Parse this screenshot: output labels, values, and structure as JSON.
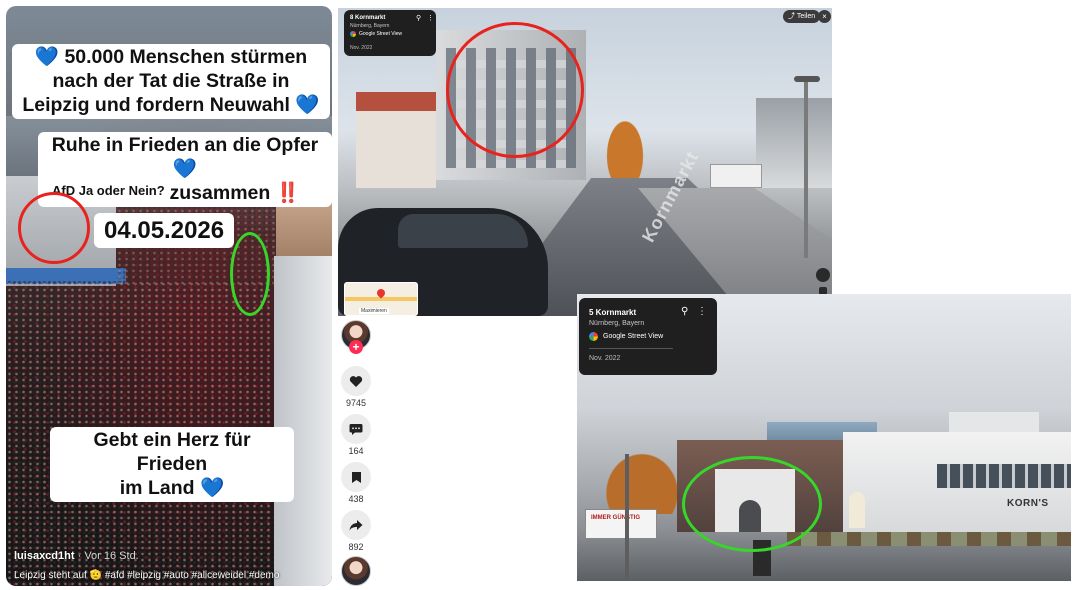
{
  "tiktok": {
    "caption_main": "💙 50.000 Menschen stürmen nach der Tat die Straße in Leipzig und fordern Neuwahl 💙",
    "caption_main_lines": [
      "50.000 Menschen stürmen",
      "nach der Tat die Straße in",
      "Leipzig und fordern Neuwahl"
    ],
    "caption_ruhe_line1": "Ruhe in Frieden an die Opfer",
    "caption_ruhe_line2": "Wir halten zusammen",
    "caption_afd": "AfD Ja oder Nein?",
    "caption_date": "04.05.2026",
    "caption_herz_line1": "Gebt ein Herz für Frieden",
    "caption_herz_line2": "im Land",
    "username": "luisaxcd1ht",
    "time_ago": "· Vor 16 Std.",
    "description": "Leipzig steht auf 🫡 #afd #leipzig #auto #aliceweidel #demo",
    "emoji_heart": "💙",
    "emoji_bang": "‼️"
  },
  "actions": {
    "likes": "9745",
    "comments": "164",
    "saves": "438",
    "shares": "892",
    "plus": "+"
  },
  "streetview_top": {
    "title": "8 Kornmarkt",
    "location": "Nürnberg, Bayern",
    "provider": "Google Street View",
    "date": "Nov. 2022",
    "street_label": "Kornmarkt",
    "share_label": "Teilen",
    "close_label": "×",
    "minimap_label": "Maximieren"
  },
  "streetview_bottom": {
    "title": "5 Kornmarkt",
    "location": "Nürnberg, Bayern",
    "provider": "Google Street View",
    "date": "Nov. 2022",
    "store_sign": "KORN'S",
    "truck_text": "IMMER GÜNSTIG"
  },
  "colors": {
    "red_circle": "#e8231d",
    "green_circle": "#38d52a",
    "heart_blue": "#2f86e6",
    "tiktok_red": "#fe2c55"
  }
}
